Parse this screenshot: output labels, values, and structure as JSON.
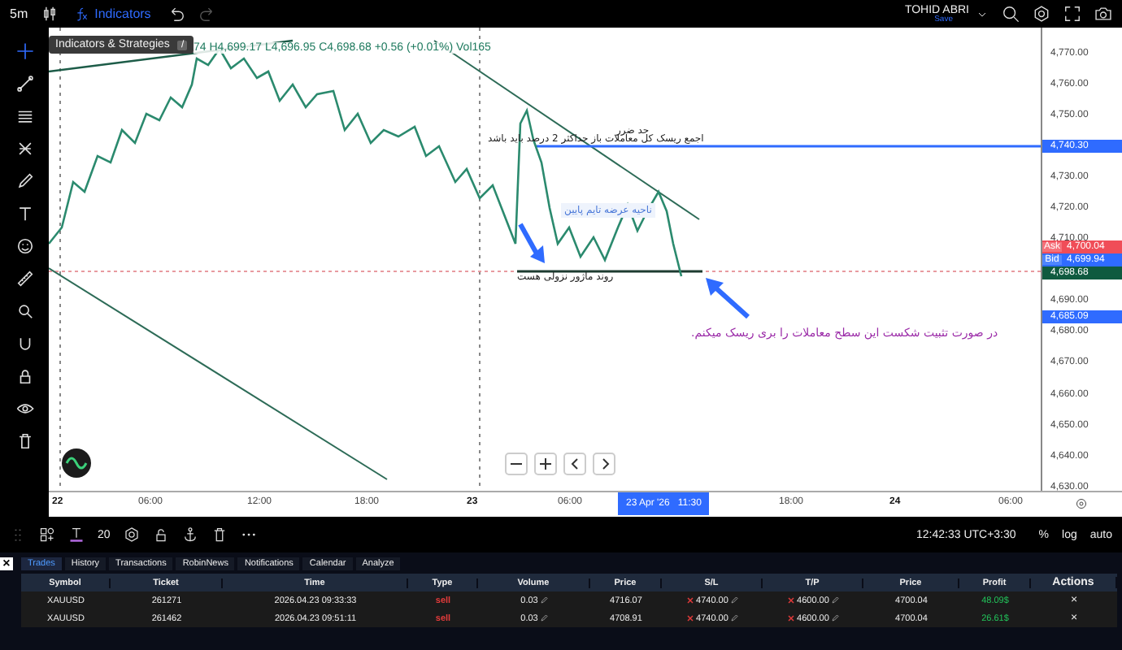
{
  "top_bar": {
    "interval": "5m",
    "indicators_button": "Indicators",
    "user_name": "TOHID ABRI",
    "save_label": "Save"
  },
  "chart": {
    "tooltip": {
      "label": "Indicators & Strategies",
      "shortcut": "/"
    },
    "legend": "74 H4,699.17 L4,696.95 C4,698.68 +0.56 (+0.01%) Vol165",
    "annotations": [
      {
        "kind": "plain",
        "text": "حد ضرر"
      },
      {
        "kind": "plain",
        "text": "اجمع ریسک کل معاملات باز حداکثر 2 درصد باید باشد"
      },
      {
        "kind": "boxed",
        "text": "ناحیه عرضه تایم پایین"
      },
      {
        "kind": "plain",
        "text": "روند ماژور نزولی هست"
      },
      {
        "kind": "note",
        "text": "در صورت تثبیت شکست این سطح معاملات را بری ریسک میکنم."
      }
    ]
  },
  "price_axis": {
    "labels": [
      "4,770.00",
      "4,760.00",
      "4,750.00",
      "4,730.00",
      "4,720.00",
      "4,710.00",
      "4,690.00",
      "4,680.00",
      "4,670.00",
      "4,660.00",
      "4,650.00",
      "4,640.00",
      "4,630.00"
    ],
    "badges": [
      {
        "kind": "line",
        "value": "4,740.30"
      },
      {
        "kind": "ask",
        "label": "Ask",
        "value": "4,700.04"
      },
      {
        "kind": "bid",
        "label": "Bid",
        "value": "4,699.94"
      },
      {
        "kind": "last",
        "value": "4,698.68"
      },
      {
        "kind": "line",
        "value": "4,685.09"
      }
    ]
  },
  "time_axis": {
    "labels": [
      {
        "text": "22",
        "bold": true
      },
      {
        "text": "06:00",
        "bold": false
      },
      {
        "text": "12:00",
        "bold": false
      },
      {
        "text": "18:00",
        "bold": false
      },
      {
        "text": "23",
        "bold": true
      },
      {
        "text": "06:00",
        "bold": false
      },
      {
        "text": "18:00",
        "bold": false
      },
      {
        "text": "24",
        "bold": true
      },
      {
        "text": "06:00",
        "bold": false
      }
    ],
    "cursor_label": "23 Apr '26   11:30"
  },
  "bottom_toolbar": {
    "font_size": "20",
    "clock": "12:42:33 UTC+3:30",
    "options": [
      "%",
      "log",
      "auto"
    ]
  },
  "panel": {
    "close": "×",
    "tabs": [
      {
        "label": "Trades",
        "selected": true
      },
      {
        "label": "History",
        "selected": false
      },
      {
        "label": "Transactions",
        "selected": false
      },
      {
        "label": "RobinNews",
        "selected": false
      },
      {
        "label": "Notifications",
        "selected": false
      },
      {
        "label": "Calendar",
        "selected": false
      },
      {
        "label": "Analyze",
        "selected": false
      }
    ],
    "columns": [
      "Symbol",
      "Ticket",
      "Time",
      "Type",
      "Volume",
      "Price",
      "S/L",
      "T/P",
      "Price",
      "Profit",
      "Actions"
    ],
    "rows": [
      {
        "symbol": "XAUUSD",
        "ticket": "261271",
        "time": "2026.04.23 09:33:33",
        "type": "sell",
        "volume": "0.03",
        "price": "4716.07",
        "sl": "4740.00",
        "tp": "4600.00",
        "current_price": "4700.04",
        "profit": "48.09$",
        "action": "×"
      },
      {
        "symbol": "XAUUSD",
        "ticket": "261462",
        "time": "2026.04.23 09:51:11",
        "type": "sell",
        "volume": "0.03",
        "price": "4708.91",
        "sl": "4740.00",
        "tp": "4600.00",
        "current_price": "4700.04",
        "profit": "26.61$",
        "action": "×"
      }
    ]
  }
}
